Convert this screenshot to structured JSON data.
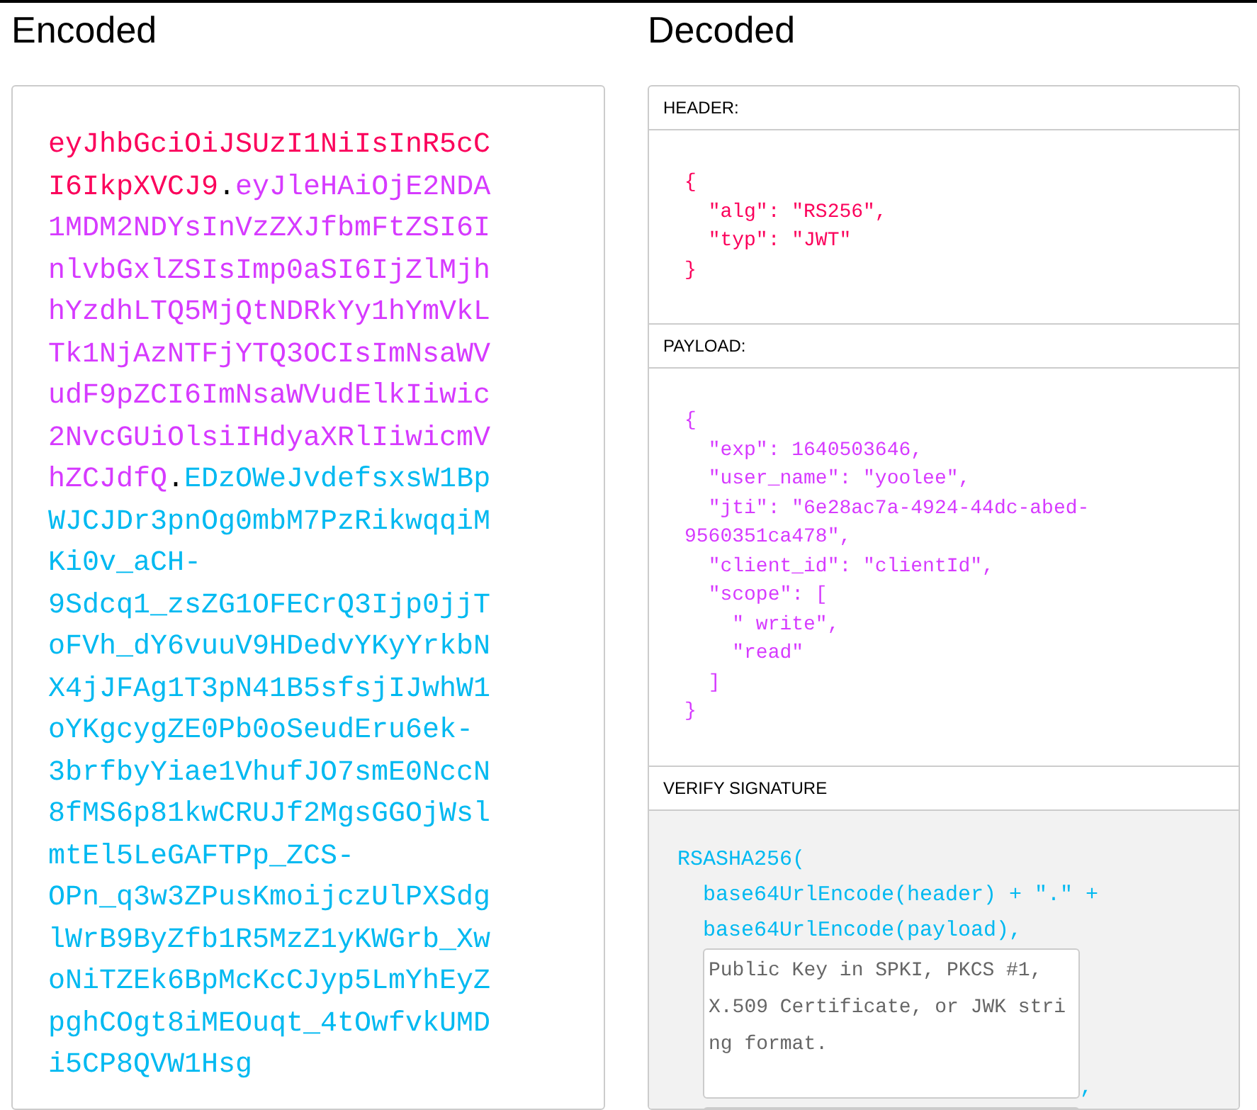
{
  "encoded": {
    "title": "Encoded",
    "token": [
      {
        "kind": "header",
        "text": "eyJhbGciOiJSUzI1NiIsInR5cCI6IkpXVCJ9"
      },
      {
        "kind": "dot",
        "text": "."
      },
      {
        "kind": "payload",
        "text": "eyJleHAiOjE2NDA1MDM2NDYsInVzZXJfbmFtZSI6InlvbGxlZSIsImp0aSI6IjZlMjhhYzdhLTQ5MjQtNDRkYy1hYmVkLTk1NjAzNTFjYTQ3OCIsImNsaWVudF9pZCI6ImNsaWVudElkIiwic2NvcGUiOlsiIHdyaXRlIiwicmVhZCJdfQ"
      },
      {
        "kind": "dot",
        "text": "."
      },
      {
        "kind": "signature",
        "text": "EDzOWeJvdefsxsW1BpWJCJDr3pnOg0mbM7PzRikwqqiMKi0v_aCH-9Sdcq1_zsZG1OFECrQ3Ijp0jjToFVh_dY6vuuV9HDedvYKyYrkbNX4jJFAg1T3pN41B5sfsjIJwhW1oYKgcygZE0Pb0oSeudEru6ek-3brfbyYiae1VhufJO7smE0NccN8fMS6p81kwCRUJf2MgsGGOjWslmtEl5LeGAFTPp_ZCS-OPn_q3w3ZPusKmoijczUlPXSdglWrB9ByZfb1R5MzZ1yKWGrb_XwoNiTZEk6BpMcKcCJyp5LmYhEyZpghCOgt8iMEOuqt_4tOwfvkUMDi5CP8QVW1Hsg"
      }
    ]
  },
  "decoded": {
    "title": "Decoded",
    "sections": [
      {
        "kind": "header",
        "label": "HEADER:",
        "lines": [
          "{",
          "  \"alg\": \"RS256\",",
          "  \"typ\": \"JWT\"",
          "}"
        ]
      },
      {
        "kind": "payload",
        "label": "PAYLOAD:",
        "lines": [
          "{",
          "  \"exp\": 1640503646,",
          "  \"user_name\": \"yoolee\",",
          "  \"jti\": \"6e28ac7a-4924-44dc-abed-9560351ca478\",",
          "  \"client_id\": \"clientId\",",
          "  \"scope\": [",
          "    \" write\",",
          "    \"read\"",
          "  ]",
          "}"
        ]
      },
      {
        "kind": "signature",
        "label": "VERIFY SIGNATURE",
        "code": [
          "RSASHA256(",
          "  base64UrlEncode(header) + \".\" +",
          "  base64UrlEncode(payload),"
        ],
        "key_field": {
          "placeholder": "Public Key in SPKI, PKCS #1, X.509 Certificate, or JWK string format."
        },
        "separator": ","
      }
    ]
  }
}
